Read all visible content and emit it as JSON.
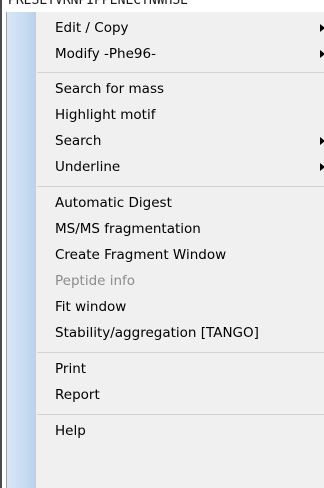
{
  "background_text": "PRESLYVRNPIPPENLCTNWHSE",
  "menu": {
    "items": [
      {
        "label": "Edit / Copy",
        "submenu": true,
        "disabled": false
      },
      {
        "label": "Modify -Phe96-",
        "submenu": true,
        "disabled": false
      },
      {
        "label": "Search for mass",
        "submenu": false,
        "disabled": false
      },
      {
        "label": "Highlight motif",
        "submenu": false,
        "disabled": false
      },
      {
        "label": "Search",
        "submenu": true,
        "disabled": false
      },
      {
        "label": "Underline",
        "submenu": true,
        "disabled": false
      },
      {
        "label": "Automatic Digest",
        "submenu": false,
        "disabled": false
      },
      {
        "label": "MS/MS fragmentation",
        "submenu": false,
        "disabled": false
      },
      {
        "label": "Create Fragment Window",
        "submenu": false,
        "disabled": false
      },
      {
        "label": "Peptide info",
        "submenu": false,
        "disabled": true
      },
      {
        "label": "Fit window",
        "submenu": false,
        "disabled": false
      },
      {
        "label": "Stability/aggregation [TANGO]",
        "submenu": false,
        "disabled": false
      },
      {
        "label": "Print",
        "submenu": false,
        "disabled": false
      },
      {
        "label": "Report",
        "submenu": false,
        "disabled": false
      },
      {
        "label": "Help",
        "submenu": false,
        "disabled": false
      }
    ]
  },
  "colors": {
    "menu_background": "#f0f0f0",
    "gutter": "#c9dcf1",
    "disabled_text": "#8c8c8c",
    "separator": "#d2d2d2"
  }
}
